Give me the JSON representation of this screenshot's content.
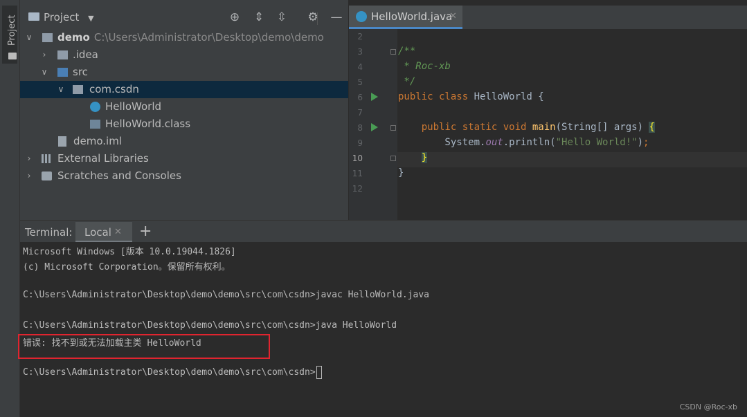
{
  "side_stripe": {
    "label": "Project"
  },
  "project_panel": {
    "title": "Project",
    "tree": [
      {
        "label": "demo",
        "path": "C:\\Users\\Administrator\\Desktop\\demo\\demo",
        "expanded": true,
        "icon": "module-folder-icon"
      },
      {
        "label": ".idea",
        "expanded": false,
        "icon": "folder-icon"
      },
      {
        "label": "src",
        "expanded": true,
        "icon": "source-folder-icon"
      },
      {
        "label": "com.csdn",
        "expanded": true,
        "icon": "package-icon",
        "selected": true
      },
      {
        "label": "HelloWorld",
        "icon": "java-class-icon"
      },
      {
        "label": "HelloWorld.class",
        "icon": "class-file-icon"
      },
      {
        "label": "demo.iml",
        "icon": "iml-file-icon"
      },
      {
        "label": "External Libraries",
        "expanded": false,
        "icon": "libraries-icon"
      },
      {
        "label": "Scratches and Consoles",
        "expanded": false,
        "icon": "scratches-icon"
      }
    ]
  },
  "editor": {
    "tab_label": "HelloWorld.java",
    "line_numbers": [
      "2",
      "3",
      "4",
      "5",
      "6",
      "7",
      "8",
      "9",
      "10",
      "11",
      "12"
    ],
    "current_line": "10",
    "lines": [
      "",
      "/**",
      " * Roc-xb",
      " */",
      "public class HelloWorld {",
      "",
      "    public static void main(String[] args) {",
      "        System.out.println(\"Hello World!\");",
      "    }",
      "}",
      ""
    ]
  },
  "terminal": {
    "title": "Terminal:",
    "tab_label": "Local",
    "lines": [
      "Microsoft Windows [版本 10.0.19044.1826]",
      "(c) Microsoft Corporation。保留所有权利。",
      "",
      "C:\\Users\\Administrator\\Desktop\\demo\\demo\\src\\com\\csdn>javac HelloWorld.java",
      "",
      "C:\\Users\\Administrator\\Desktop\\demo\\demo\\src\\com\\csdn>java HelloWorld",
      "错误: 找不到或无法加载主类 HelloWorld",
      "",
      "C:\\Users\\Administrator\\Desktop\\demo\\demo\\src\\com\\csdn>"
    ]
  },
  "watermark": "CSDN @Roc-xb",
  "colors": {
    "accent": "#4a88c7",
    "selection": "#0d293e",
    "error_box": "#e0242f",
    "run_icon": "#499c54"
  }
}
